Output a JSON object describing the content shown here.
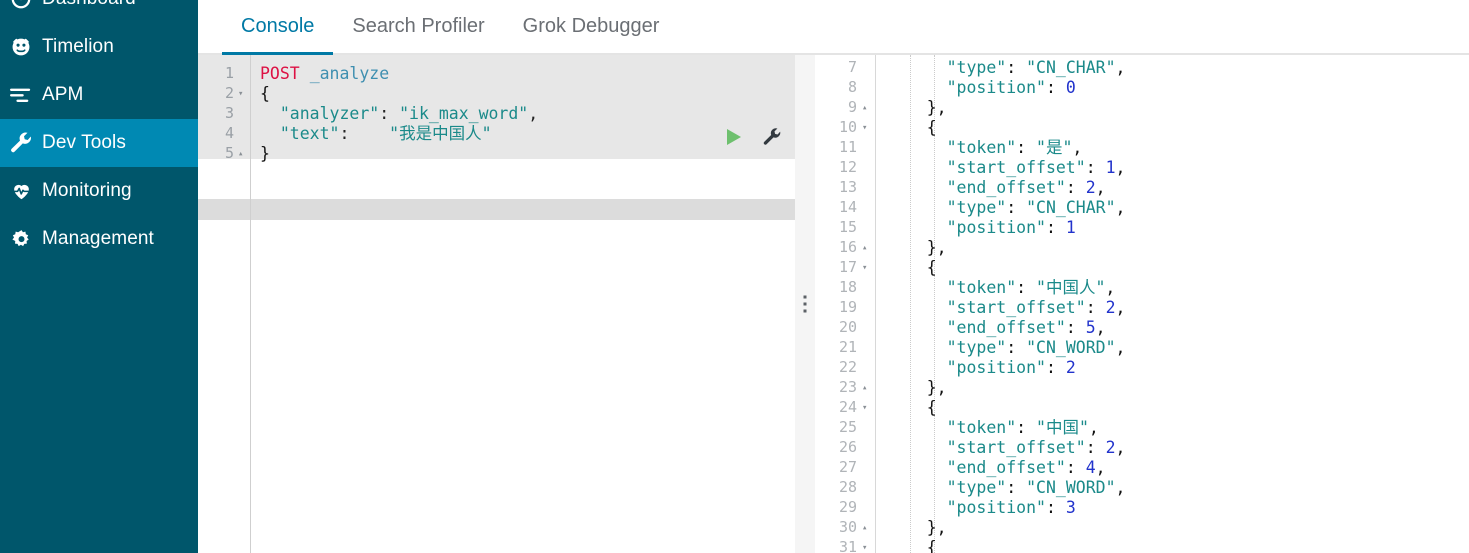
{
  "sidebar": {
    "items": [
      {
        "label": "Dashboard",
        "icon": "dashboard-icon",
        "active": false
      },
      {
        "label": "Timelion",
        "icon": "timelion-icon",
        "active": false
      },
      {
        "label": "APM",
        "icon": "apm-icon",
        "active": false
      },
      {
        "label": "Dev Tools",
        "icon": "wrench-icon",
        "active": true
      },
      {
        "label": "Monitoring",
        "icon": "heartbeat-icon",
        "active": false
      },
      {
        "label": "Management",
        "icon": "gear-icon",
        "active": false
      }
    ],
    "bg_color": "#00566b",
    "active_color": "#0089b3"
  },
  "tabs": [
    {
      "label": "Console",
      "active": true
    },
    {
      "label": "Search Profiler",
      "active": false
    },
    {
      "label": "Grok Debugger",
      "active": false
    }
  ],
  "accent_color": "#0079a5",
  "editor": {
    "active_line": 5,
    "toolbar": {
      "run_label": "Click to send request",
      "wrench_label": "Open documentation"
    },
    "lines": [
      {
        "num": "1",
        "fold": "",
        "tokens": [
          {
            "t": "POST",
            "c": "k-method"
          },
          {
            "t": " ",
            "c": "k-punc"
          },
          {
            "t": "_analyze",
            "c": "k-url"
          }
        ]
      },
      {
        "num": "2",
        "fold": "▾",
        "tokens": [
          {
            "t": "{",
            "c": "k-brace"
          }
        ]
      },
      {
        "num": "3",
        "fold": "",
        "tokens": [
          {
            "t": "  \"analyzer\"",
            "c": "k-key"
          },
          {
            "t": ": ",
            "c": "k-punc"
          },
          {
            "t": "\"ik_max_word\"",
            "c": "k-str"
          },
          {
            "t": ",",
            "c": "k-punc"
          }
        ]
      },
      {
        "num": "4",
        "fold": "",
        "tokens": [
          {
            "t": "  \"text\"",
            "c": "k-key"
          },
          {
            "t": ":    ",
            "c": "k-punc"
          },
          {
            "t": "\"",
            "c": "k-str"
          },
          {
            "t": "我是中国人",
            "c": "k-cjk"
          },
          {
            "t": "\"",
            "c": "k-str"
          }
        ]
      },
      {
        "num": "5",
        "fold": "▴",
        "tokens": [
          {
            "t": "}",
            "c": "k-brace"
          }
        ]
      }
    ]
  },
  "response": {
    "lines": [
      {
        "num": "7",
        "fold": "",
        "clipped": "top",
        "tokens": [
          {
            "t": "      \"type\"",
            "c": "r-key"
          },
          {
            "t": ": ",
            "c": "r-brace"
          },
          {
            "t": "\"CN_CHAR\"",
            "c": "r-str"
          },
          {
            "t": ",",
            "c": "r-brace"
          }
        ]
      },
      {
        "num": "8",
        "fold": "",
        "tokens": [
          {
            "t": "      \"position\"",
            "c": "r-key"
          },
          {
            "t": ": ",
            "c": "r-brace"
          },
          {
            "t": "0",
            "c": "r-num"
          }
        ]
      },
      {
        "num": "9",
        "fold": "▴",
        "tokens": [
          {
            "t": "    },",
            "c": "r-brace"
          }
        ]
      },
      {
        "num": "10",
        "fold": "▾",
        "tokens": [
          {
            "t": "    {",
            "c": "r-brace"
          }
        ]
      },
      {
        "num": "11",
        "fold": "",
        "tokens": [
          {
            "t": "      \"token\"",
            "c": "r-key"
          },
          {
            "t": ": ",
            "c": "r-brace"
          },
          {
            "t": "\"",
            "c": "r-str"
          },
          {
            "t": "是",
            "c": "r-cjk"
          },
          {
            "t": "\"",
            "c": "r-str"
          },
          {
            "t": ",",
            "c": "r-brace"
          }
        ]
      },
      {
        "num": "12",
        "fold": "",
        "tokens": [
          {
            "t": "      \"start_offset\"",
            "c": "r-key"
          },
          {
            "t": ": ",
            "c": "r-brace"
          },
          {
            "t": "1",
            "c": "r-num"
          },
          {
            "t": ",",
            "c": "r-brace"
          }
        ]
      },
      {
        "num": "13",
        "fold": "",
        "tokens": [
          {
            "t": "      \"end_offset\"",
            "c": "r-key"
          },
          {
            "t": ": ",
            "c": "r-brace"
          },
          {
            "t": "2",
            "c": "r-num"
          },
          {
            "t": ",",
            "c": "r-brace"
          }
        ]
      },
      {
        "num": "14",
        "fold": "",
        "tokens": [
          {
            "t": "      \"type\"",
            "c": "r-key"
          },
          {
            "t": ": ",
            "c": "r-brace"
          },
          {
            "t": "\"CN_CHAR\"",
            "c": "r-str"
          },
          {
            "t": ",",
            "c": "r-brace"
          }
        ]
      },
      {
        "num": "15",
        "fold": "",
        "tokens": [
          {
            "t": "      \"position\"",
            "c": "r-key"
          },
          {
            "t": ": ",
            "c": "r-brace"
          },
          {
            "t": "1",
            "c": "r-num"
          }
        ]
      },
      {
        "num": "16",
        "fold": "▴",
        "tokens": [
          {
            "t": "    },",
            "c": "r-brace"
          }
        ]
      },
      {
        "num": "17",
        "fold": "▾",
        "tokens": [
          {
            "t": "    {",
            "c": "r-brace"
          }
        ]
      },
      {
        "num": "18",
        "fold": "",
        "tokens": [
          {
            "t": "      \"token\"",
            "c": "r-key"
          },
          {
            "t": ": ",
            "c": "r-brace"
          },
          {
            "t": "\"",
            "c": "r-str"
          },
          {
            "t": "中国人",
            "c": "r-cjk"
          },
          {
            "t": "\"",
            "c": "r-str"
          },
          {
            "t": ",",
            "c": "r-brace"
          }
        ]
      },
      {
        "num": "19",
        "fold": "",
        "tokens": [
          {
            "t": "      \"start_offset\"",
            "c": "r-key"
          },
          {
            "t": ": ",
            "c": "r-brace"
          },
          {
            "t": "2",
            "c": "r-num"
          },
          {
            "t": ",",
            "c": "r-brace"
          }
        ]
      },
      {
        "num": "20",
        "fold": "",
        "tokens": [
          {
            "t": "      \"end_offset\"",
            "c": "r-key"
          },
          {
            "t": ": ",
            "c": "r-brace"
          },
          {
            "t": "5",
            "c": "r-num"
          },
          {
            "t": ",",
            "c": "r-brace"
          }
        ]
      },
      {
        "num": "21",
        "fold": "",
        "tokens": [
          {
            "t": "      \"type\"",
            "c": "r-key"
          },
          {
            "t": ": ",
            "c": "r-brace"
          },
          {
            "t": "\"CN_WORD\"",
            "c": "r-str"
          },
          {
            "t": ",",
            "c": "r-brace"
          }
        ]
      },
      {
        "num": "22",
        "fold": "",
        "tokens": [
          {
            "t": "      \"position\"",
            "c": "r-key"
          },
          {
            "t": ": ",
            "c": "r-brace"
          },
          {
            "t": "2",
            "c": "r-num"
          }
        ]
      },
      {
        "num": "23",
        "fold": "▴",
        "tokens": [
          {
            "t": "    },",
            "c": "r-brace"
          }
        ]
      },
      {
        "num": "24",
        "fold": "▾",
        "tokens": [
          {
            "t": "    {",
            "c": "r-brace"
          }
        ]
      },
      {
        "num": "25",
        "fold": "",
        "tokens": [
          {
            "t": "      \"token\"",
            "c": "r-key"
          },
          {
            "t": ": ",
            "c": "r-brace"
          },
          {
            "t": "\"",
            "c": "r-str"
          },
          {
            "t": "中国",
            "c": "r-cjk"
          },
          {
            "t": "\"",
            "c": "r-str"
          },
          {
            "t": ",",
            "c": "r-brace"
          }
        ]
      },
      {
        "num": "26",
        "fold": "",
        "tokens": [
          {
            "t": "      \"start_offset\"",
            "c": "r-key"
          },
          {
            "t": ": ",
            "c": "r-brace"
          },
          {
            "t": "2",
            "c": "r-num"
          },
          {
            "t": ",",
            "c": "r-brace"
          }
        ]
      },
      {
        "num": "27",
        "fold": "",
        "tokens": [
          {
            "t": "      \"end_offset\"",
            "c": "r-key"
          },
          {
            "t": ": ",
            "c": "r-brace"
          },
          {
            "t": "4",
            "c": "r-num"
          },
          {
            "t": ",",
            "c": "r-brace"
          }
        ]
      },
      {
        "num": "28",
        "fold": "",
        "tokens": [
          {
            "t": "      \"type\"",
            "c": "r-key"
          },
          {
            "t": ": ",
            "c": "r-brace"
          },
          {
            "t": "\"CN_WORD\"",
            "c": "r-str"
          },
          {
            "t": ",",
            "c": "r-brace"
          }
        ]
      },
      {
        "num": "29",
        "fold": "",
        "tokens": [
          {
            "t": "      \"position\"",
            "c": "r-key"
          },
          {
            "t": ": ",
            "c": "r-brace"
          },
          {
            "t": "3",
            "c": "r-num"
          }
        ]
      },
      {
        "num": "30",
        "fold": "▴",
        "tokens": [
          {
            "t": "    },",
            "c": "r-brace"
          }
        ]
      },
      {
        "num": "31",
        "fold": "▾",
        "clipped": "bottom",
        "tokens": [
          {
            "t": "    {",
            "c": "r-brace"
          }
        ]
      }
    ]
  }
}
